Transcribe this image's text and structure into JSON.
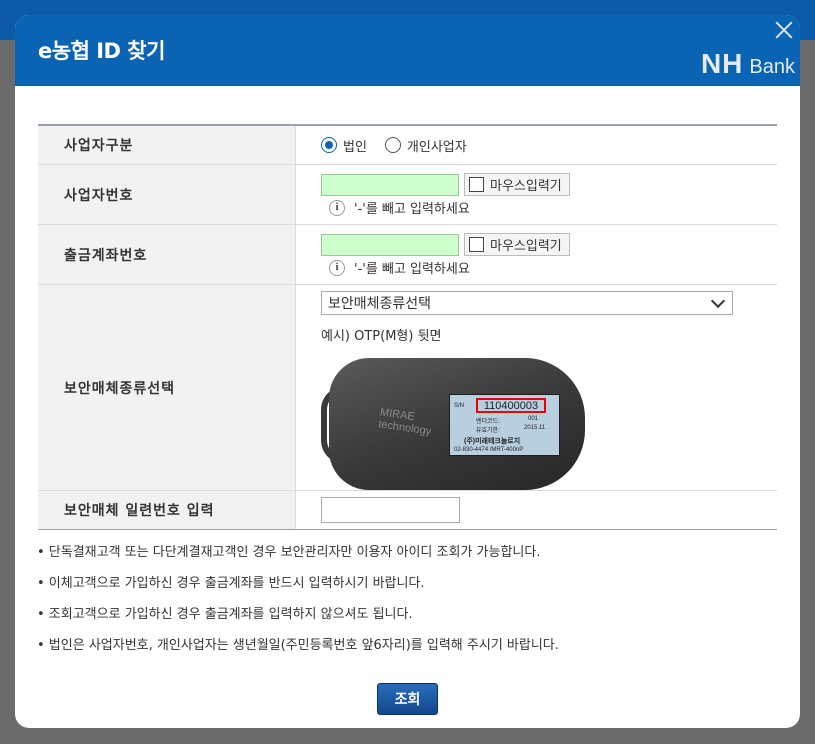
{
  "dialog": {
    "title": "e농협 ID 찾기",
    "logo_nh": "NH",
    "logo_bank": "Bank"
  },
  "form": {
    "business_type": {
      "label": "사업자구분",
      "options": [
        "법인",
        "개인사업자"
      ],
      "selected": "법인"
    },
    "business_number": {
      "label": "사업자번호",
      "value": "",
      "mouse_input_label": "마우스입력기",
      "hint": "'-'를 빼고 입력하세요"
    },
    "account_number": {
      "label": "출금계좌번호",
      "value": "",
      "mouse_input_label": "마우스입력기",
      "hint": "'-'를 빼고 입력하세요"
    },
    "security_media": {
      "label": "보안매체종류선택",
      "select_value": "보안매체종류선택",
      "example": "예시) OTP(M형) 뒷면"
    },
    "serial_number": {
      "label": "보안매체 일련번호 입력",
      "value": ""
    }
  },
  "otp_image": {
    "brand_line1": "MIRAE",
    "brand_line2": "technology",
    "sn_label": "S/N",
    "serial": "110400003",
    "line1_label": "벤더코드:",
    "line1_value": "001",
    "line2_label": "유효기한:",
    "line2_value": "2015.11",
    "company": "(주)미래테크놀로지",
    "phone": "02-830-4474 /MRT-400nP"
  },
  "notes": [
    "• 단독결재고객 또는 다단계결재고객인 경우 보안관리자만 이용자 아이디 조회가 가능합니다.",
    "• 이체고객으로 가입하신 경우 출금계좌를 반드시 입력하시기 바랍니다.",
    "• 조회고객으로 가입하신 경우 출금계좌를 입력하지 않으셔도 됩니다.",
    "• 법인은 사업자번호, 개인사업자는 생년월일(주민등록번호 앞6자리)를 입력해 주시기 바랍니다."
  ],
  "submit_label": "조회",
  "colors": {
    "header": "#0b63b3",
    "input_green": "#ccffcc",
    "serial_highlight": "#ee0000"
  }
}
